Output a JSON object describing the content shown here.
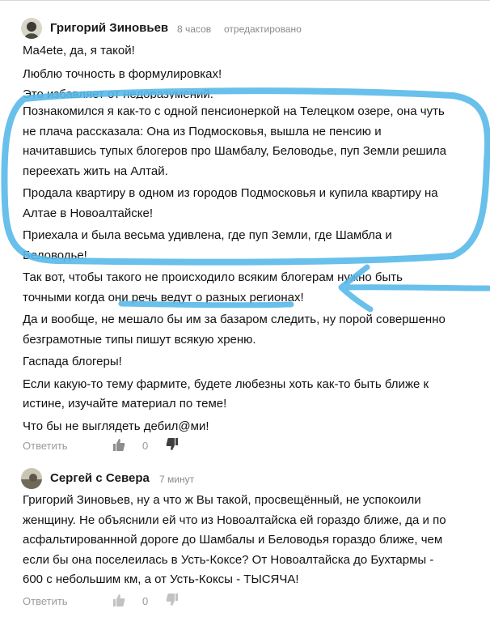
{
  "comments": [
    {
      "author": "Григорий Зиновьев",
      "time": "8 часов",
      "edited": "отредактировано",
      "lines": [
        "Ma4ete, да, я такой!",
        "Люблю точность в формулировках!",
        "Это избавляет от недоразумений.",
        "Познакомился я как-то с одной пенсионеркой на Телецком озере, она чуть",
        "не плача рассказала: Она из Подмосковья, вышла не пенсию и",
        "начитавшись тупых блогеров про Шамбалу, Беловодье, пуп Земли решила",
        "переехать жить на Алтай.",
        "Продала квартиру в одном из городов Подмосковья и купила квартиру на",
        "Алтае в Новоалтайске!",
        "Приехала и была весьма удивлена, где пуп Земли, где Шамбла и",
        "Беловодье!",
        "Так вот, чтобы такого не происходило всяким блогерам нужно быть",
        "точными когда они речь ведут о разных регионах!",
        "Да и вообще, не мешало бы им за базаром следить, ну порой совершенно",
        "безграмотные типы пишут всякую хреню.",
        "Гаспада блогеры!",
        "Если какую-то тему фармите, будете любезны хоть как-то быть ближе к",
        "истине, изучайте материал по теме!",
        "Что бы не выглядеть дебил@ми!"
      ],
      "reply_label": "Ответить",
      "likes": "0"
    },
    {
      "author": "Сергей с Севера",
      "time": "7 минут",
      "lines": [
        "Григорий Зиновьев, ну а что ж Вы такой, просвещённый, не успокоили",
        "женщину. Не объяснили ей что из Новоалтайска ей гораздо ближе, да и по",
        "асфальтированнной дороге до Шамбалы и Беловодья гораздо ближе, чем",
        "если бы она поселеилась в Усть-Коксе? От Новоалтайска до Бухтармы -",
        "600 с небольшим км, а от Усть-Коксы - ТЫСЯЧА!"
      ],
      "reply_label": "Ответить",
      "likes": "0"
    }
  ],
  "icons": {
    "like": "thumbs-up-icon",
    "dislike": "thumbs-down-icon"
  },
  "colors": {
    "annotation": "#58b9e9",
    "meta_text": "#8a8a8a"
  }
}
